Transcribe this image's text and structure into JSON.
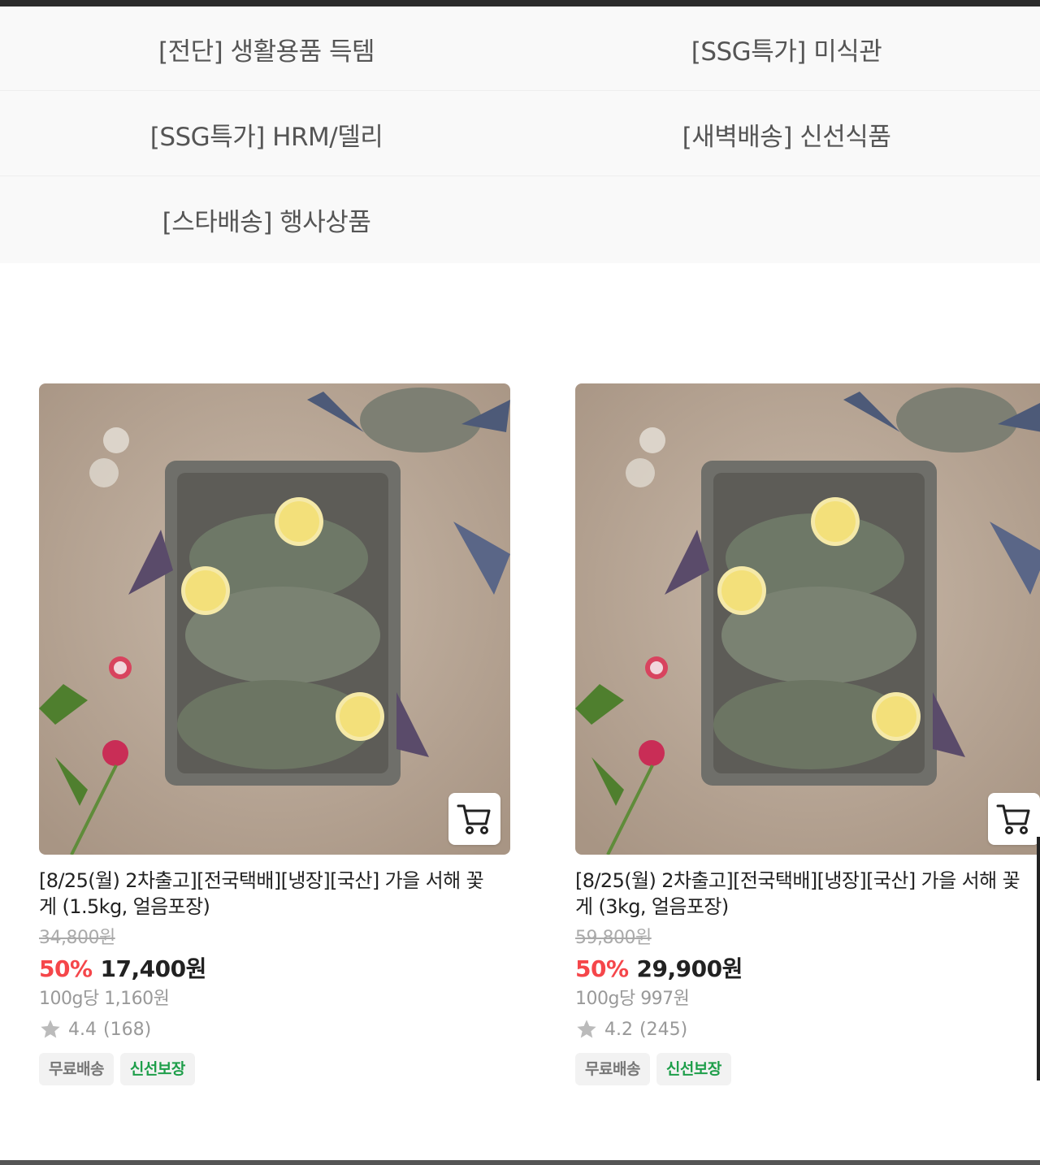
{
  "categories": [
    {
      "label": "[전단] 생활용품 득템"
    },
    {
      "label": "[SSG특가] 미식관"
    },
    {
      "label": "[SSG특가] HRM/델리"
    },
    {
      "label": "[새벽배송] 신선식품"
    },
    {
      "label": "[스타배송] 행사상품"
    }
  ],
  "products": [
    {
      "title": "[8/25(월) 2차출고][전국택배][냉장][국산] 가을 서해 꽃게 (1.5kg, 얼음포장)",
      "original_price": "34,800원",
      "discount": "50%",
      "price": "17,400원",
      "unit_price": "100g당 1,160원",
      "rating": "4.4",
      "review_count": "(168)",
      "badges": [
        "무료배송",
        "신선보장"
      ]
    },
    {
      "title": "[8/25(월) 2차출고][전국택배][냉장][국산] 가을 서해 꽃게 (3kg, 얼음포장)",
      "original_price": "59,800원",
      "discount": "50%",
      "price": "29,900원",
      "unit_price": "100g당 997원",
      "rating": "4.2",
      "review_count": "(245)",
      "badges": [
        "무료배송",
        "신선보장"
      ]
    }
  ],
  "colors": {
    "discount": "#f5464a",
    "fresh_badge": "#1e9e4a",
    "category_bg": "#f9f9f9"
  },
  "icons": {
    "cart": "cart-icon",
    "star": "star-icon"
  }
}
